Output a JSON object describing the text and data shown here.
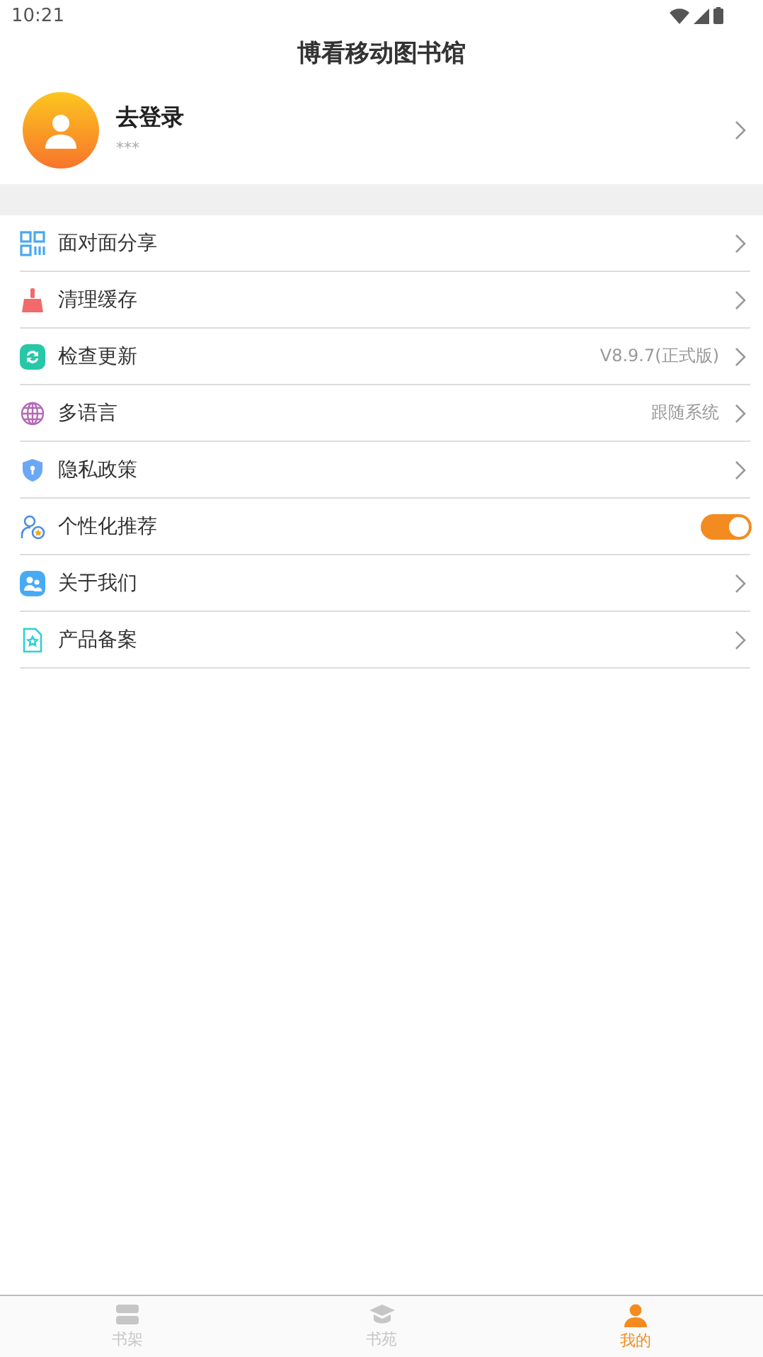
{
  "status_bar": {
    "time": "10:21"
  },
  "header": {
    "title": "博看移动图书馆"
  },
  "profile": {
    "name": "去登录",
    "account": "***"
  },
  "menu": [
    {
      "kind": "link",
      "label": "面对面分享"
    },
    {
      "kind": "link",
      "label": "清理缓存"
    },
    {
      "kind": "link",
      "label": "检查更新",
      "value": "V8.9.7(正式版)"
    },
    {
      "kind": "link",
      "label": "多语言",
      "value": "跟随系统"
    },
    {
      "kind": "link",
      "label": "隐私政策"
    },
    {
      "kind": "toggle",
      "label": "个性化推荐",
      "on": true
    },
    {
      "kind": "link",
      "label": "关于我们"
    },
    {
      "kind": "link",
      "label": "产品备案"
    }
  ],
  "tab_bar": [
    {
      "label": "书架",
      "selected": false
    },
    {
      "label": "书苑",
      "selected": false
    },
    {
      "label": "我的",
      "selected": true
    }
  ]
}
